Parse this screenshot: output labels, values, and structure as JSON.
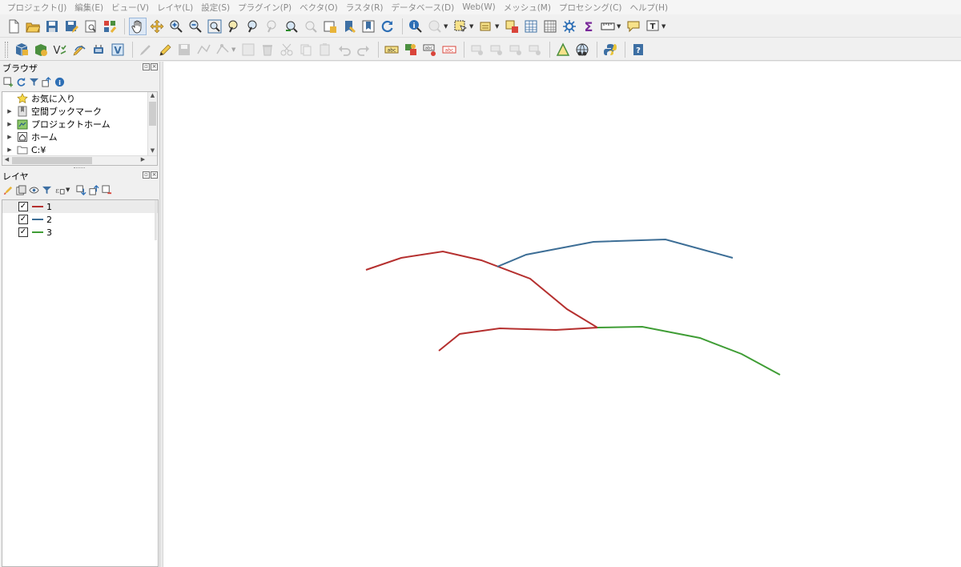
{
  "menu": [
    "プロジェクト(J)",
    "編集(E)",
    "ビュー(V)",
    "レイヤ(L)",
    "設定(S)",
    "プラグイン(P)",
    "ベクタ(O)",
    "ラスタ(R)",
    "データベース(D)",
    "Web(W)",
    "メッシュ(M)",
    "プロセシング(C)",
    "ヘルプ(H)"
  ],
  "browser": {
    "title": "ブラウザ",
    "items": [
      {
        "label": "お気に入り",
        "icon": "star-icon",
        "expandable": false
      },
      {
        "label": "空間ブックマーク",
        "icon": "bookmark-icon",
        "expandable": true
      },
      {
        "label": "プロジェクトホーム",
        "icon": "project-home-icon",
        "expandable": true
      },
      {
        "label": "ホーム",
        "icon": "home-icon",
        "expandable": true
      },
      {
        "label": "C:¥",
        "icon": "folder-icon",
        "expandable": true
      }
    ]
  },
  "layers": {
    "title": "レイヤ",
    "items": [
      {
        "label": "1",
        "color": "#b5302f",
        "checked": true,
        "selected": true
      },
      {
        "label": "2",
        "color": "#3d6e96",
        "checked": true,
        "selected": false
      },
      {
        "label": "3",
        "color": "#3f9d35",
        "checked": true,
        "selected": false
      }
    ]
  },
  "map_features": [
    {
      "layer": "1",
      "color": "#b5302f"
    },
    {
      "layer": "2",
      "color": "#3d6e96"
    },
    {
      "layer": "3",
      "color": "#3f9d35"
    }
  ]
}
